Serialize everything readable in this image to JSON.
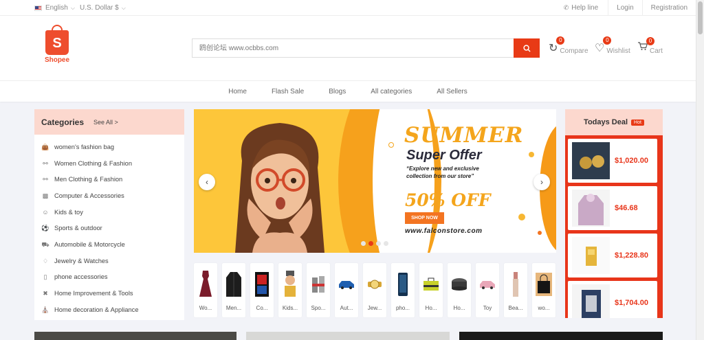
{
  "topbar": {
    "language": "English",
    "currency": "U.S. Dollar $",
    "help": "Help line",
    "login": "Login",
    "register": "Registration"
  },
  "logo": {
    "name": "Shopee",
    "letter": "S"
  },
  "search": {
    "placeholder": "鸥创论坛 www.ocbbs.com"
  },
  "header_icons": {
    "compare": {
      "label": "Compare",
      "count": "0"
    },
    "wishlist": {
      "label": "Wishlist",
      "count": "0"
    },
    "cart": {
      "label": "Cart",
      "count": "0"
    }
  },
  "nav": [
    "Home",
    "Flash Sale",
    "Blogs",
    "All categories",
    "All Sellers"
  ],
  "categories": {
    "title": "Categories",
    "see_all": "See All >",
    "items": [
      "women's fashion bag",
      "Women Clothing & Fashion",
      "Men Clothing & Fashion",
      "Computer & Accessories",
      "Kids & toy",
      "Sports & outdoor",
      "Automobile & Motorcycle",
      "Jewelry & Watches",
      "phone accessories",
      "Home Improvement & Tools",
      "Home decoration & Appliance"
    ]
  },
  "banner": {
    "line1": "SUMMER",
    "line2": "Super Offer",
    "line3": "“Explore new and exclusive collection from our store”",
    "line4": "50% OFF",
    "cta": "SHOP NOW",
    "site": "www.falconstore.com",
    "slides": 4,
    "active_slide": 2
  },
  "strip": [
    "Wo...",
    "Men...",
    "Co...",
    "Kids...",
    "Spo...",
    "Aut...",
    "Jew...",
    "pho...",
    "Ho...",
    "Ho...",
    "Toy",
    "Bea...",
    "wo..."
  ],
  "deal": {
    "title": "Todays Deal",
    "hot": "Hot",
    "items": [
      {
        "price": "$1,020.00"
      },
      {
        "price": "$46.68"
      },
      {
        "price": "$1,228.80"
      },
      {
        "price": "$1,704.00"
      }
    ]
  },
  "colors": {
    "accent": "#e83a16",
    "brand": "#ee4d2d",
    "banner_yellow": "#fdc63a",
    "header_pink": "#fcd8ce"
  }
}
